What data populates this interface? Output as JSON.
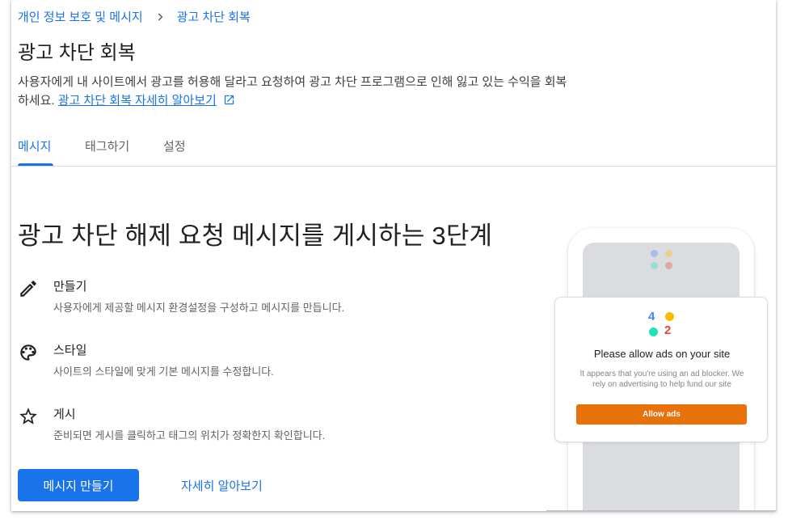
{
  "breadcrumb": {
    "parent": "개인 정보 보호 및 메시지",
    "current": "광고 차단 회복"
  },
  "page": {
    "title": "광고 차단 회복",
    "description": "사용자에게 내 사이트에서 광고를 허용해 달라고 요청하여 광고 차단 프로그램으로 인해 잃고 있는 수익을 회복하세요.",
    "learn_link": "광고 차단 회복 자세히 알아보기"
  },
  "tabs": [
    {
      "label": "메시지",
      "active": true
    },
    {
      "label": "태그하기",
      "active": false
    },
    {
      "label": "설정",
      "active": false
    }
  ],
  "section": {
    "title": "광고 차단 해제 요청 메시지를 게시하는 3단계"
  },
  "steps": [
    {
      "icon": "pencil-icon",
      "title": "만들기",
      "desc": "사용자에게 제공할 메시지 환경설정을 구성하고 메시지를 만듭니다."
    },
    {
      "icon": "palette-icon",
      "title": "스타일",
      "desc": "사이트의 스타일에 맞게 기본 메시지를 수정합니다."
    },
    {
      "icon": "star-icon",
      "title": "게시",
      "desc": "준비되면 게시를 클릭하고 태그의 위치가 정확한지 확인합니다."
    }
  ],
  "actions": {
    "primary": "메시지 만들기",
    "secondary": "자세히 알아보기"
  },
  "illustration": {
    "logo_digits": [
      "4",
      "2"
    ],
    "popup_title": "Please allow ads on your site",
    "popup_text": "It appears that you're using an ad blocker. We rely on advertising to help fund our site",
    "button_label": "Allow ads"
  },
  "colors": {
    "accent": "#1a73e8",
    "allow_button": "#e8710a",
    "logo_blue": "#4285f4",
    "logo_yellow": "#fbbc04",
    "logo_green": "#1ee3b7",
    "logo_red": "#ea4335"
  }
}
